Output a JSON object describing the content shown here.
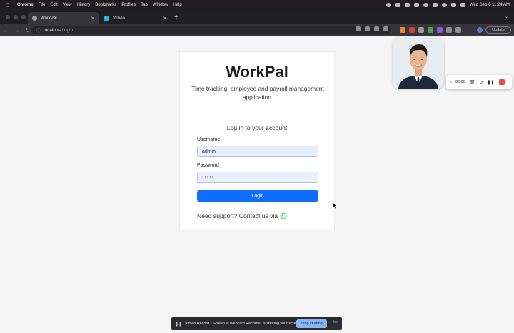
{
  "menubar": {
    "app": "Chrome",
    "items": [
      "File",
      "Edit",
      "View",
      "History",
      "Bookmarks",
      "Profiles",
      "Tab",
      "Window",
      "Help"
    ],
    "datetime": "Wed Sep 6  11:24 AM"
  },
  "tabs": [
    {
      "title": "WorkPal",
      "icon": "globe-icon",
      "active": true
    },
    {
      "title": "Vimeo",
      "icon": "vimeo-icon",
      "active": false
    }
  ],
  "toolbar": {
    "url_host": "localhost",
    "url_path": "/login",
    "update_label": "Update"
  },
  "login": {
    "app_title": "WorkPal",
    "tagline": "Time tracking, employee and payroll management application.",
    "subtitle": "Log in to your account",
    "username_label": "Username",
    "username_value": "admin",
    "password_label": "Password",
    "password_value": "•••••",
    "login_button": "Login",
    "support_text": "Need support? Contact us via"
  },
  "recorder": {
    "timer": "00:00"
  },
  "share_bar": {
    "message": "Vimeo Record - Screen & Webcam Recorder is sharing your screen.",
    "stop_label": "Stop sharing",
    "hide_label": "Hide"
  },
  "colors": {
    "primary_button": "#0d6efd",
    "record_stop": "#e74c3c",
    "whatsapp": "#25d366"
  }
}
